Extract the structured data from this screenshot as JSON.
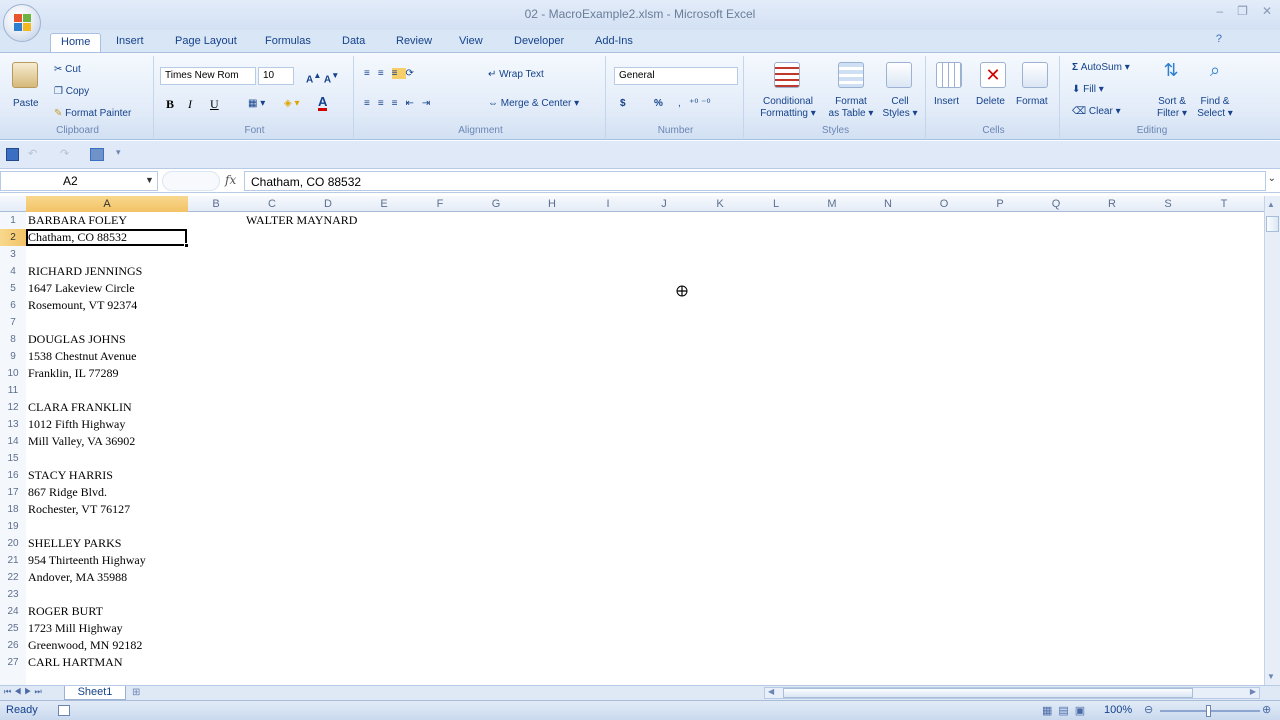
{
  "window": {
    "title": "02 - MacroExample2.xlsm - Microsoft Excel",
    "controls": [
      "–",
      "❐",
      "✕"
    ]
  },
  "tabs": [
    "Home",
    "Insert",
    "Page Layout",
    "Formulas",
    "Data",
    "Review",
    "View",
    "Developer",
    "Add-Ins"
  ],
  "ribbon": {
    "clipboard": {
      "label": "Clipboard",
      "paste": "Paste",
      "cut": "Cut",
      "copy": "Copy",
      "format_painter": "Format Painter"
    },
    "font": {
      "label": "Font",
      "name": "Times New Rom",
      "size": "10",
      "bold": "B",
      "italic": "I",
      "underline": "U"
    },
    "alignment": {
      "label": "Alignment",
      "wrap": "Wrap Text",
      "merge": "Merge & Center"
    },
    "number": {
      "label": "Number",
      "format": "General",
      "currency": "$",
      "percent": "%"
    },
    "styles": {
      "label": "Styles",
      "conditional": [
        "Conditional",
        "Formatting"
      ],
      "format_table": [
        "Format",
        "as Table"
      ],
      "cell_styles": [
        "Cell",
        "Styles"
      ]
    },
    "cells": {
      "label": "Cells",
      "insert": "Insert",
      "delete": "Delete",
      "format": "Format"
    },
    "editing": {
      "label": "Editing",
      "autosum": "AutoSum",
      "fill": "Fill",
      "clear": "Clear",
      "sort": [
        "Sort &",
        "Filter"
      ],
      "find": [
        "Find &",
        "Select"
      ]
    }
  },
  "formula_bar": {
    "name_box": "A2",
    "fx": "fx",
    "content": "Chatham, CO 88532"
  },
  "columns": [
    "A",
    "B",
    "C",
    "D",
    "E",
    "F",
    "G",
    "H",
    "I",
    "J",
    "K",
    "L",
    "M",
    "N",
    "O",
    "P",
    "Q",
    "R",
    "S",
    "T"
  ],
  "rows": [
    "1",
    "2",
    "3",
    "4",
    "5",
    "6",
    "7",
    "8",
    "9",
    "10",
    "11",
    "12",
    "13",
    "14",
    "15",
    "16",
    "17",
    "18",
    "19",
    "20",
    "21",
    "22",
    "23",
    "24",
    "25",
    "26",
    "27"
  ],
  "cells": {
    "A1": "BARBARA FOLEY",
    "A2": "Chatham, CO 88532",
    "A4": "RICHARD JENNINGS",
    "A5": "1647 Lakeview Circle",
    "A6": "Rosemount, VT 92374",
    "A8": "DOUGLAS JOHNS",
    "A9": "1538 Chestnut Avenue",
    "A10": "Franklin, IL 77289",
    "A12": "CLARA FRANKLIN",
    "A13": "1012 Fifth Highway",
    "A14": "Mill Valley, VA 36902",
    "A16": "STACY HARRIS",
    "A17": "867 Ridge Blvd.",
    "A18": "Rochester, VT 76127",
    "A20": "SHELLEY PARKS",
    "A21": "954 Thirteenth Highway",
    "A22": "Andover, MA 35988",
    "A24": "ROGER BURT",
    "A25": "1723 Mill Highway",
    "A26": "Greenwood, MN 92182",
    "A27": "CARL HARTMAN",
    "C1": "WALTER MAYNARD"
  },
  "sheet_tab": "Sheet1",
  "status": {
    "ready": "Ready",
    "zoom": "100%"
  },
  "colors": {
    "ribbon_text": "#15428b",
    "selected_header": "#f3c266"
  }
}
